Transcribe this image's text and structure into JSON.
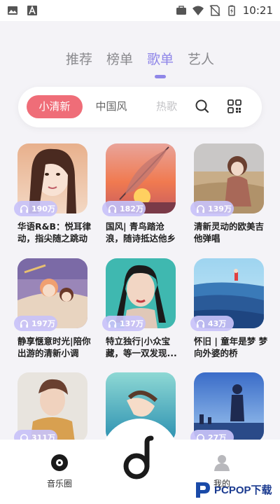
{
  "status_bar": {
    "time": "10:21",
    "icons": [
      "image-icon",
      "a-icon",
      "briefcase-icon",
      "wifi-icon",
      "no-sim-icon",
      "battery-charging-icon"
    ]
  },
  "top_tabs": [
    {
      "label": "推荐",
      "active": false
    },
    {
      "label": "榜单",
      "active": false
    },
    {
      "label": "歌单",
      "active": true
    },
    {
      "label": "艺人",
      "active": false
    }
  ],
  "categories": [
    {
      "label": "小清新",
      "active": true
    },
    {
      "label": "中国风",
      "active": false
    },
    {
      "label": "热歌",
      "active": false
    }
  ],
  "playlists": [
    {
      "count": "190万",
      "title": "华语R&B：悦耳律动，指尖随之跳动"
    },
    {
      "count": "182万",
      "title": "国风| 青鸟踏沧浪，随诗抵达他乡"
    },
    {
      "count": "139万",
      "title": "清新灵动的欧美吉他弹唱"
    },
    {
      "count": "197万",
      "title": "静享惬意时光|陪你出游的清新小调"
    },
    {
      "count": "137万",
      "title": "特立独行|小众宝藏，等一双发现..."
    },
    {
      "count": "43万",
      "title": "怀旧 | 童年是梦 梦向外婆的桥"
    },
    {
      "count": "311万",
      "title": ""
    },
    {
      "count": "",
      "title": ""
    },
    {
      "count": "27万",
      "title": ""
    }
  ],
  "bottom_nav": {
    "left_label": "音乐圈",
    "right_label": "我的"
  },
  "watermark": "PCPOP下载",
  "colors": {
    "accent": "#8f86e8",
    "chip_active": "#ef6d78",
    "badge": "#c8c2f8"
  }
}
